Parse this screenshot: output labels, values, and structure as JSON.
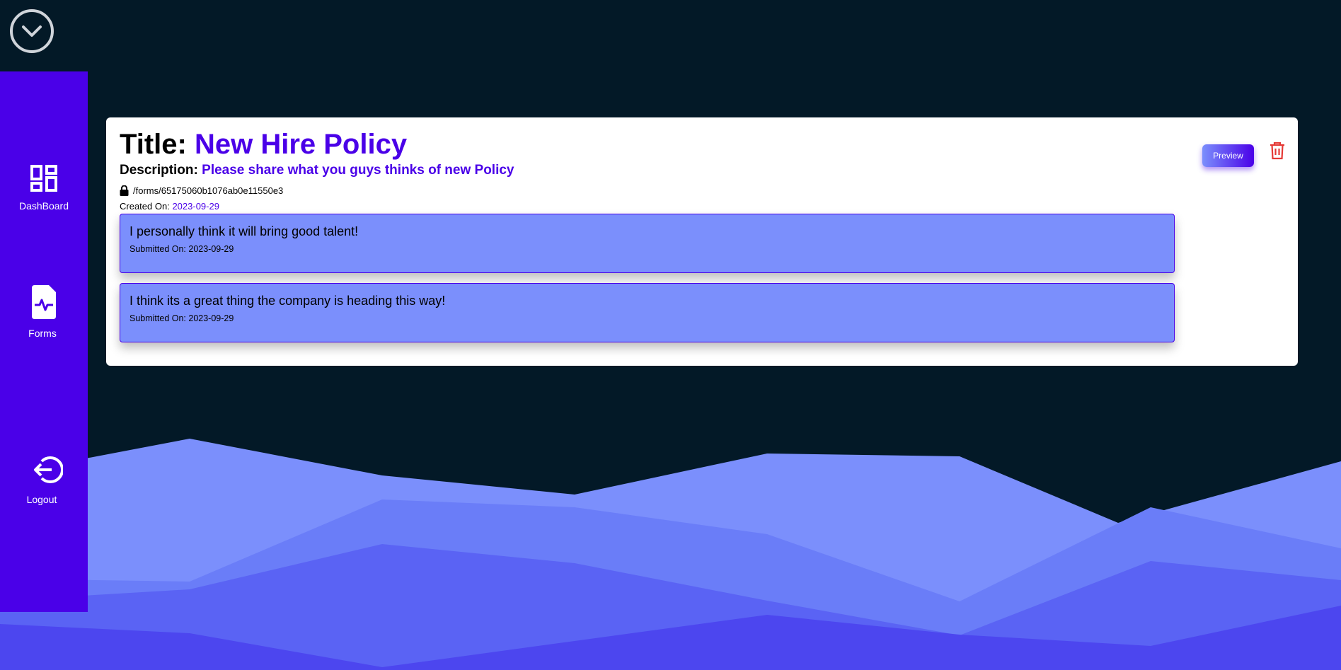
{
  "sidebar": {
    "items": [
      {
        "label": "DashBoard",
        "icon": "dashboard-icon"
      },
      {
        "label": "Forms",
        "icon": "form-document-icon"
      },
      {
        "label": "Logout",
        "icon": "logout-icon"
      }
    ]
  },
  "form": {
    "title_label": "Title:",
    "title_value": "New Hire Policy",
    "description_label": "Description:",
    "description_value": "Please share what you guys thinks of new Policy",
    "path": "/forms/65175060b1076ab0e11550e3",
    "created_label": "Created On:",
    "created_value": "2023-09-29",
    "preview_label": "Preview"
  },
  "responses": [
    {
      "text": "I personally think it will bring good talent!",
      "submitted": "Submitted On: 2023-09-29"
    },
    {
      "text": "I think its a great thing the company is heading this way!",
      "submitted": "Submitted On: 2023-09-29"
    }
  ],
  "colors": {
    "background": "#031927",
    "accent": "#4a00e8",
    "response_bg": "#7b8ffc",
    "delete": "#e53935"
  }
}
